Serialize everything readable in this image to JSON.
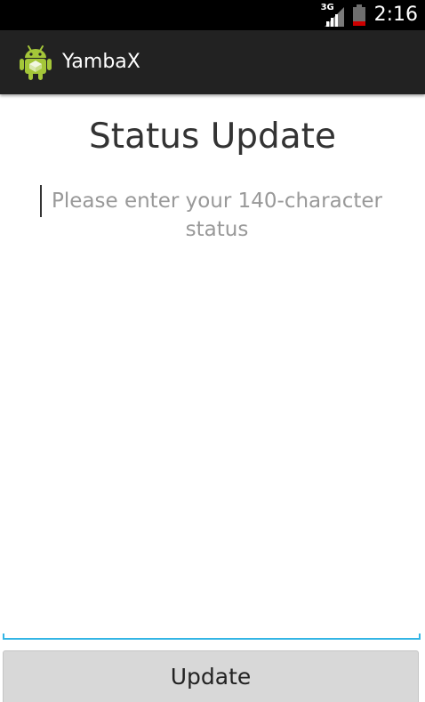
{
  "status_bar": {
    "network_type": "3G",
    "time": "2:16",
    "icons": [
      "signal-icon",
      "battery-icon"
    ]
  },
  "action_bar": {
    "icon": "android-icon",
    "title": "YambaX"
  },
  "main": {
    "title": "Status Update",
    "status_input": {
      "value": "",
      "placeholder": "Please enter your 140-character status"
    },
    "update_button_label": "Update"
  },
  "colors": {
    "action_bar_bg": "#222222",
    "accent": "#33b5e5",
    "android_green": "#a4c639",
    "button_bg": "#d8d8d8"
  }
}
